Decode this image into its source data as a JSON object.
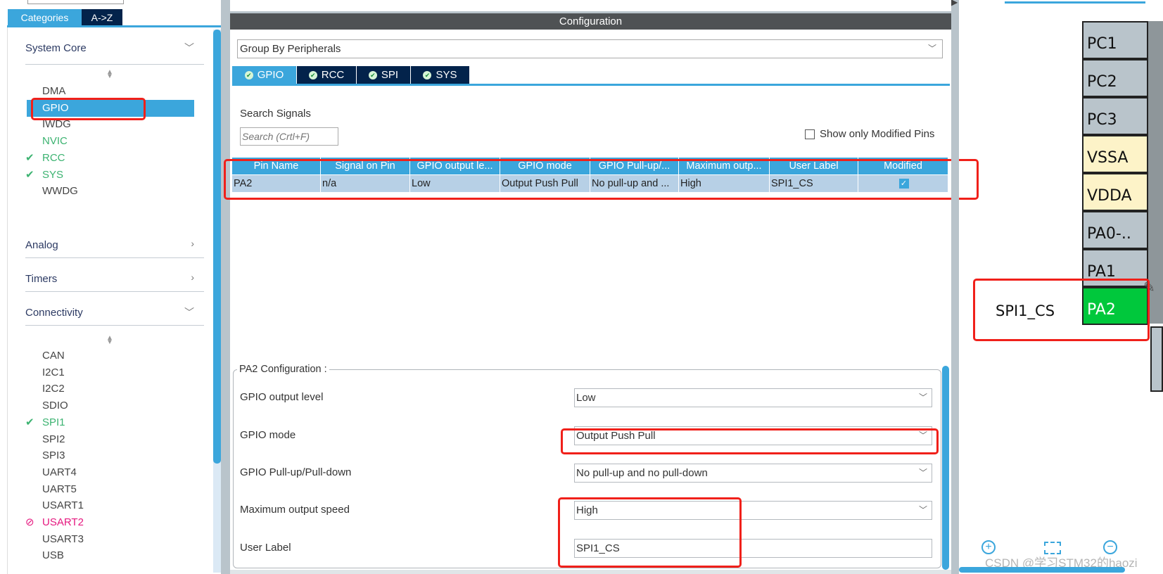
{
  "left_panel": {
    "tabs": [
      "Categories",
      "A->Z"
    ],
    "system_core": {
      "title": "System Core",
      "items": [
        {
          "label": "DMA",
          "state": "normal"
        },
        {
          "label": "GPIO",
          "state": "selected"
        },
        {
          "label": "IWDG",
          "state": "normal"
        },
        {
          "label": "NVIC",
          "state": "configured-partial"
        },
        {
          "label": "RCC",
          "state": "ok"
        },
        {
          "label": "SYS",
          "state": "ok"
        },
        {
          "label": "WWDG",
          "state": "normal"
        }
      ]
    },
    "analog": {
      "title": "Analog"
    },
    "timers": {
      "title": "Timers"
    },
    "connectivity": {
      "title": "Connectivity",
      "items": [
        {
          "label": "CAN",
          "state": "normal"
        },
        {
          "label": "I2C1",
          "state": "normal"
        },
        {
          "label": "I2C2",
          "state": "normal"
        },
        {
          "label": "SDIO",
          "state": "normal"
        },
        {
          "label": "SPI1",
          "state": "ok"
        },
        {
          "label": "SPI2",
          "state": "normal"
        },
        {
          "label": "SPI3",
          "state": "normal"
        },
        {
          "label": "UART4",
          "state": "normal"
        },
        {
          "label": "UART5",
          "state": "normal"
        },
        {
          "label": "USART1",
          "state": "normal"
        },
        {
          "label": "USART2",
          "state": "conflict"
        },
        {
          "label": "USART3",
          "state": "normal"
        },
        {
          "label": "USB",
          "state": "normal"
        }
      ]
    }
  },
  "config": {
    "title": "Configuration",
    "group_by": "Group By Peripherals",
    "tabs": [
      "GPIO",
      "RCC",
      "SPI",
      "SYS"
    ],
    "search_label": "Search Signals",
    "search_placeholder": "Search (Crtl+F)",
    "show_modified": "Show only Modified Pins",
    "table": {
      "columns": [
        "Pin Name",
        "Signal on Pin",
        "GPIO output le...",
        "GPIO mode",
        "GPIO Pull-up/...",
        "Maximum outp...",
        "User Label",
        "Modified"
      ],
      "rows": [
        [
          "PA2",
          "n/a",
          "Low",
          "Output Push Pull",
          "No pull-up and ...",
          "High",
          "SPI1_CS",
          true
        ]
      ]
    },
    "pin_config": {
      "title": "PA2 Configuration :",
      "fields": [
        {
          "label": "GPIO output level",
          "value": "Low"
        },
        {
          "label": "GPIO mode",
          "value": "Output Push Pull"
        },
        {
          "label": "GPIO Pull-up/Pull-down",
          "value": "No pull-up and no pull-down"
        },
        {
          "label": "Maximum output speed",
          "value": "High"
        },
        {
          "label": "User Label",
          "value": "SPI1_CS"
        }
      ]
    }
  },
  "pinout": {
    "pins": [
      {
        "name": "PC1",
        "color": "#b9c4cb"
      },
      {
        "name": "PC2",
        "color": "#b9c4cb"
      },
      {
        "name": "PC3",
        "color": "#b9c4cb"
      },
      {
        "name": "VSSA",
        "color": "#fdf3c8"
      },
      {
        "name": "VDDA",
        "color": "#fdf3c8"
      },
      {
        "name": "PA0-..",
        "color": "#b9c4cb"
      },
      {
        "name": "PA1",
        "color": "#b9c4cb"
      },
      {
        "name": "PA2",
        "color": "#00c83c"
      }
    ],
    "pa2_label": "SPI1_CS",
    "watermark": "CSDN @学习STM32的haozi"
  }
}
